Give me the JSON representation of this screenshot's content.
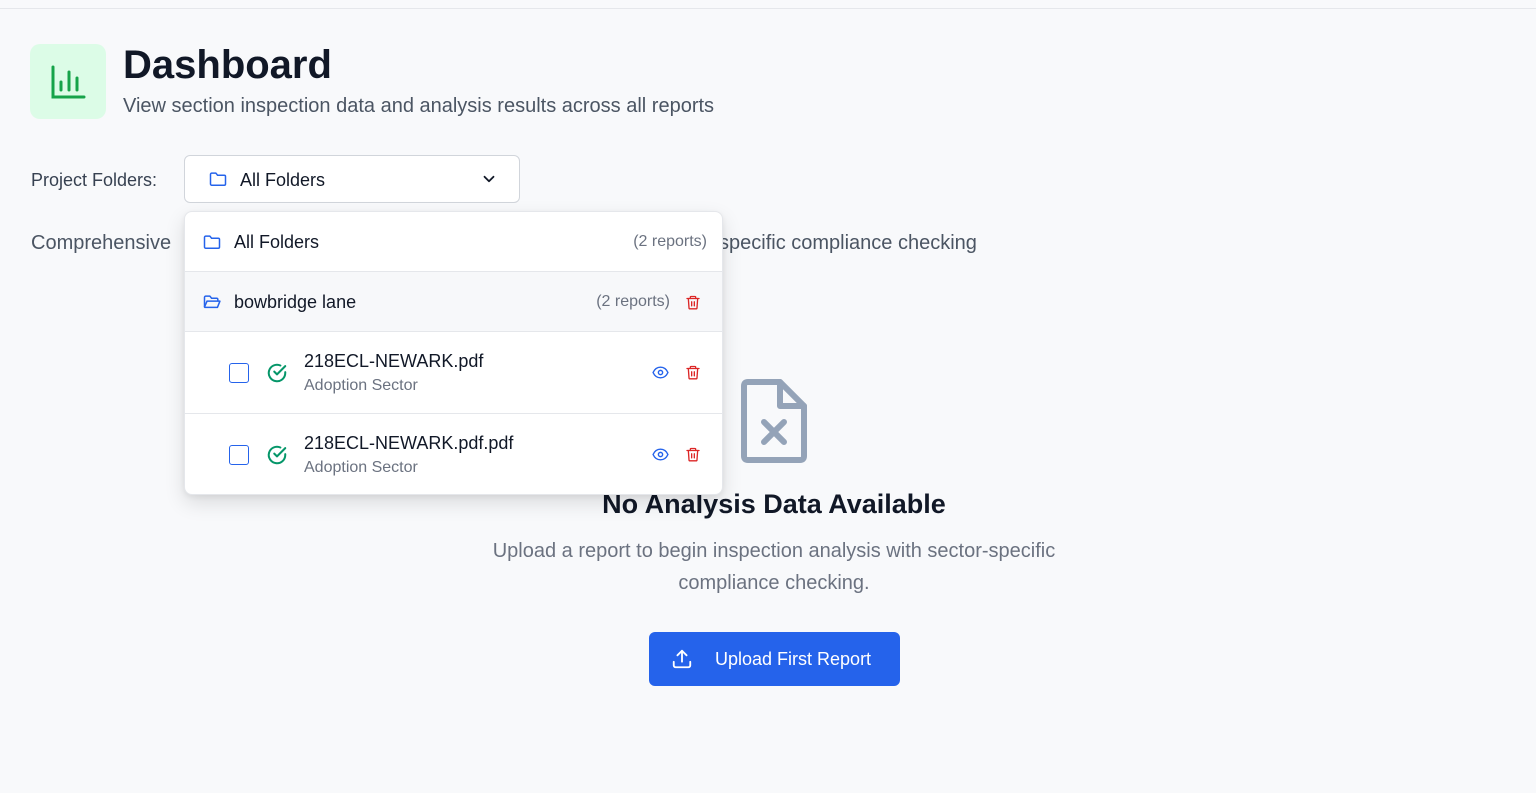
{
  "header": {
    "title": "Dashboard",
    "subtitle": "View section inspection data and analysis results across all reports",
    "icon": "bar-chart-icon"
  },
  "folder_filter": {
    "label": "Project Folders:",
    "selected": "All Folders"
  },
  "description": {
    "left_visible": "Comprehensive",
    "right_visible": "specific compliance checking"
  },
  "dropdown": {
    "all": {
      "label": "All Folders",
      "count": "(2 reports)"
    },
    "folders": [
      {
        "name": "bowbridge lane",
        "count": "(2 reports)",
        "files": [
          {
            "name": "218ECL-NEWARK.pdf",
            "sector": "Adoption Sector",
            "checked": false
          },
          {
            "name": "218ECL-NEWARK.pdf.pdf",
            "sector": "Adoption Sector",
            "checked": false
          }
        ]
      }
    ]
  },
  "empty_state": {
    "icon": "file-x-icon",
    "title": "No Analysis Data Available",
    "text": "Upload a report to begin inspection analysis with sector-specific compliance checking.",
    "button": "Upload First Report"
  },
  "colors": {
    "accent": "#2563eb",
    "success": "#059669",
    "danger": "#dc2626",
    "icon_bg": "#dcfce7",
    "icon_green": "#16a34a"
  }
}
